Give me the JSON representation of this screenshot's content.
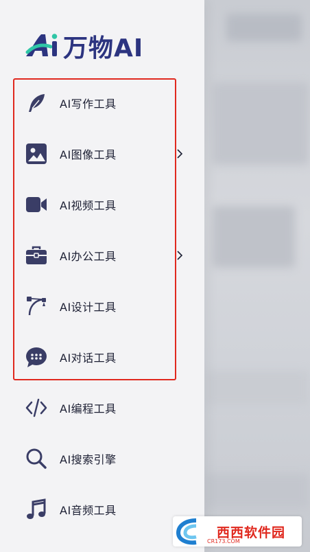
{
  "app": {
    "logo_text": "万物AI",
    "logo_letters": "Ai"
  },
  "menu": [
    {
      "label": "AI写作工具",
      "icon": "feather-icon",
      "has_submenu": false
    },
    {
      "label": "AI图像工具",
      "icon": "image-icon",
      "has_submenu": true
    },
    {
      "label": "AI视频工具",
      "icon": "video-camera-icon",
      "has_submenu": false
    },
    {
      "label": "AI办公工具",
      "icon": "briefcase-icon",
      "has_submenu": true
    },
    {
      "label": "AI设计工具",
      "icon": "bezier-pen-icon",
      "has_submenu": false
    },
    {
      "label": "AI对话工具",
      "icon": "chat-bubble-icon",
      "has_submenu": false
    },
    {
      "label": "AI编程工具",
      "icon": "code-icon",
      "has_submenu": false
    },
    {
      "label": "AI搜索引擎",
      "icon": "search-icon",
      "has_submenu": false
    },
    {
      "label": "AI音频工具",
      "icon": "music-note-icon",
      "has_submenu": false
    }
  ],
  "watermark": {
    "text": "西西软件园",
    "sub": "CR173.COM"
  },
  "colors": {
    "icon": "#3a3d66",
    "brand_dark": "#2c3480",
    "brand_accent": "#2fc6a6",
    "highlight": "#e0281e"
  }
}
